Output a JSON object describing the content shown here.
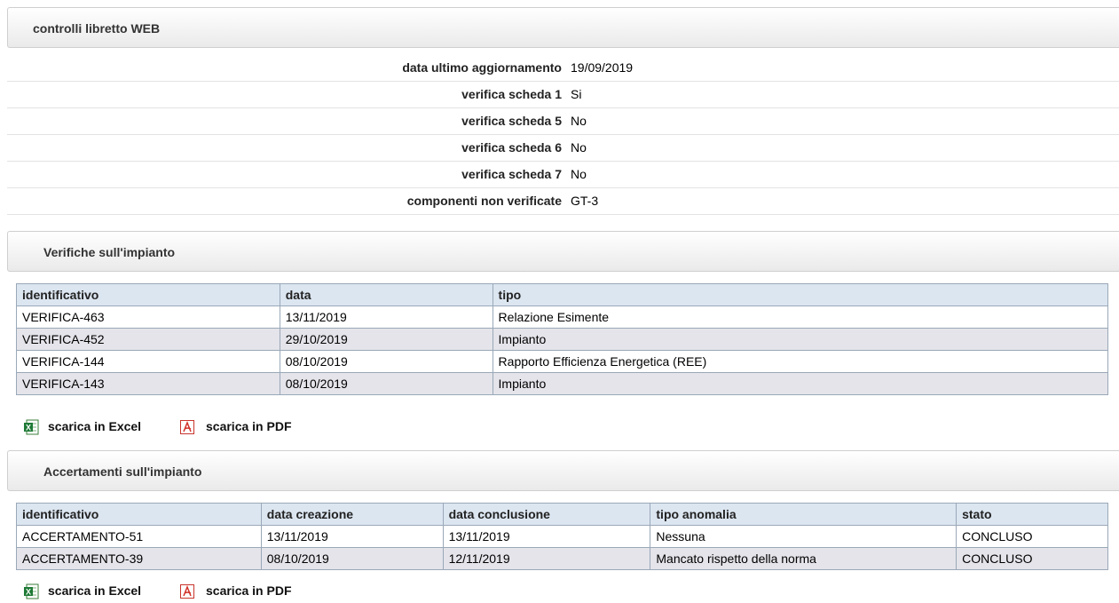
{
  "controlli": {
    "title": "controlli libretto WEB",
    "rows": [
      {
        "label": "data ultimo aggiornamento",
        "value": "19/09/2019"
      },
      {
        "label": "verifica scheda 1",
        "value": "Si"
      },
      {
        "label": "verifica scheda 5",
        "value": "No"
      },
      {
        "label": "verifica scheda 6",
        "value": "No"
      },
      {
        "label": "verifica scheda 7",
        "value": "No"
      },
      {
        "label": "componenti non verificate",
        "value": "GT-3"
      }
    ]
  },
  "verifiche": {
    "title": "Verifiche sull'impianto",
    "columns": [
      "identificativo",
      "data",
      "tipo"
    ],
    "rows": [
      [
        "VERIFICA-463",
        "13/11/2019",
        "Relazione Esimente"
      ],
      [
        "VERIFICA-452",
        "29/10/2019",
        "Impianto"
      ],
      [
        "VERIFICA-144",
        "08/10/2019",
        "Rapporto Efficienza Energetica (REE)"
      ],
      [
        "VERIFICA-143",
        "08/10/2019",
        "Impianto"
      ]
    ],
    "excel_label": "scarica in Excel",
    "pdf_label": "scarica in PDF"
  },
  "accertamenti": {
    "title": "Accertamenti sull'impianto",
    "columns": [
      "identificativo",
      "data creazione",
      "data conclusione",
      "tipo anomalia",
      "stato"
    ],
    "rows": [
      [
        "ACCERTAMENTO-51",
        "13/11/2019",
        "13/11/2019",
        "Nessuna",
        "CONCLUSO"
      ],
      [
        "ACCERTAMENTO-39",
        "08/10/2019",
        "12/11/2019",
        "Mancato rispetto della norma",
        "CONCLUSO"
      ]
    ],
    "excel_label": "scarica in Excel",
    "pdf_label": "scarica in PDF"
  }
}
